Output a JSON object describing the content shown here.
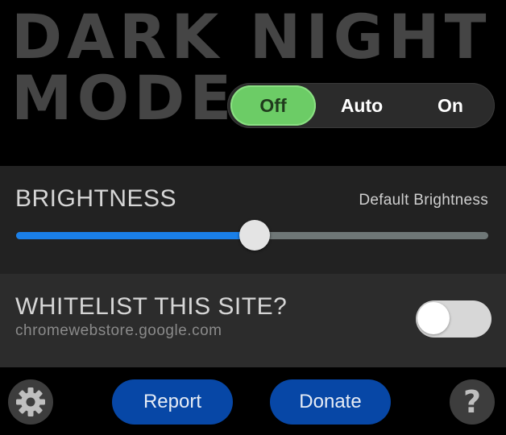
{
  "header": {
    "title_line1": "DARK NIGHT",
    "title_line2": "MODE"
  },
  "mode_switch": {
    "selected": "Off",
    "options": [
      "Off",
      "Auto",
      "On"
    ]
  },
  "brightness": {
    "title": "BRIGHTNESS",
    "default_label": "Default Brightness",
    "level_fraction": 0.505
  },
  "whitelist": {
    "title": "WHITELIST THIS SITE?",
    "site": "chromewebstore.google.com",
    "enabled": false
  },
  "footer": {
    "settings_icon": "gear-icon",
    "report_label": "Report",
    "donate_label": "Donate",
    "help_glyph": "?",
    "help_icon": "question-mark-icon"
  },
  "colors": {
    "accent_blue": "#1a7fe8",
    "button_blue": "#0747a6",
    "active_green": "#6ccc66",
    "title_gray": "#454545"
  }
}
